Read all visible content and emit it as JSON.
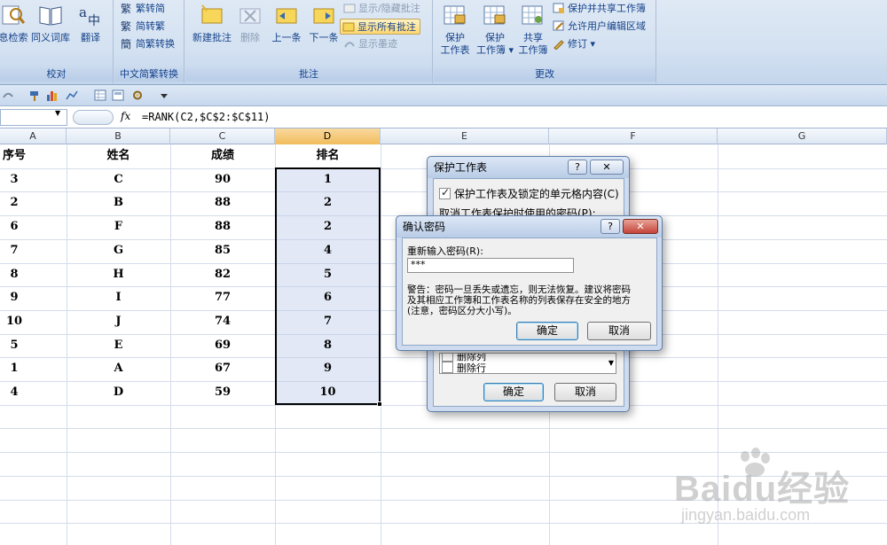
{
  "ribbon": {
    "proofing": {
      "label": "校对",
      "research": "息检索",
      "thesaurus": "同义词库",
      "translate": "翻译"
    },
    "chinese_conv": {
      "label": "中文简繁转换",
      "trad_to_simp": "繁转简",
      "simp_to_trad": "简转繁",
      "conversion": "简繁转换"
    },
    "comments": {
      "label": "批注",
      "new_comment": "新建批注",
      "delete": "删除",
      "previous": "上一条",
      "next": "下一条",
      "show_hide": "显示/隐藏批注",
      "show_all": "显示所有批注",
      "show_ink": "显示墨迹"
    },
    "changes": {
      "label": "更改",
      "protect_sheet": [
        "保护",
        "工作表"
      ],
      "protect_workbook": [
        "保护",
        "工作簿"
      ],
      "share_workbook": [
        "共享",
        "工作簿"
      ],
      "protect_share": "保护并共享工作簿",
      "allow_edit_ranges": "允许用户编辑区域",
      "track_changes": "修订"
    }
  },
  "formula_bar": {
    "fx": "fx",
    "formula": "=RANK(C2,$C$2:$C$11)"
  },
  "columns": [
    "A",
    "B",
    "C",
    "D",
    "E",
    "F",
    "G"
  ],
  "sheet": {
    "headers": [
      "序号",
      "姓名",
      "成绩",
      "排名"
    ],
    "rows": [
      [
        "3",
        "C",
        "90",
        "1"
      ],
      [
        "2",
        "B",
        "88",
        "2"
      ],
      [
        "6",
        "F",
        "88",
        "2"
      ],
      [
        "7",
        "G",
        "85",
        "4"
      ],
      [
        "8",
        "H",
        "82",
        "5"
      ],
      [
        "9",
        "I",
        "77",
        "6"
      ],
      [
        "10",
        "J",
        "74",
        "7"
      ],
      [
        "5",
        "E",
        "69",
        "8"
      ],
      [
        "1",
        "A",
        "67",
        "9"
      ],
      [
        "4",
        "D",
        "59",
        "10"
      ]
    ]
  },
  "protect_dialog": {
    "title": "保护工作表",
    "help": "?",
    "close": "✕",
    "checkbox_label": "保护工作表及锁定的单元格内容(C)",
    "password_label": "取消工作表保护时使用的密码(P):",
    "list_items": [
      "删除列",
      "删除行"
    ],
    "ok": "确定",
    "cancel": "取消"
  },
  "confirm_dialog": {
    "title": "确认密码",
    "help": "?",
    "close": "✕",
    "reenter_label": "重新输入密码(R):",
    "password_value": "***",
    "warning_lines": [
      "警告：密码一旦丢失或遗忘，则无法恢复。建议将密码",
      "及其相应工作簿和工作表名称的列表保存在安全的地方",
      "(注意，密码区分大小写)。"
    ],
    "ok": "确定",
    "cancel": "取消"
  },
  "watermark": {
    "main": "Baidu经验",
    "sub": "jingyan.baidu.com"
  }
}
